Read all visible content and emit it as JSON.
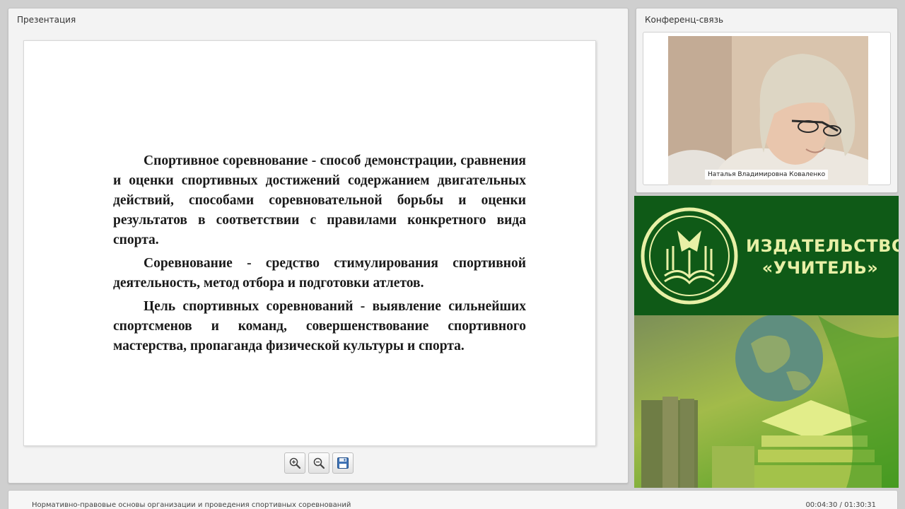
{
  "presentation": {
    "title": "Презентация",
    "paragraphs": [
      "Спортивное соревнование - способ демонстрации, сравнения и оценки спортивных достижений содержанием двигательных действий, способами соревновательной борьбы и оценки результатов в соответствии с правилами конкретного вида спорта.",
      "Соревнование - средство стимулирования спортивной деятельность, метод отбора и подготовки атлетов.",
      "Цель спортивных соревнований - выявление сильнейших спортсменов и команд, совершенствование спортивного мастерства, пропаганда физической культуры и спорта."
    ],
    "tools": [
      "zoom-in-icon",
      "zoom-out-icon",
      "save-icon"
    ]
  },
  "conference": {
    "title": "Конференц-связь",
    "participant_name": "Наталья Владимировна Коваленко"
  },
  "banner": {
    "line1": "ИЗДАТЕЛЬСТВО",
    "line2": "«УЧИТЕЛЬ»",
    "colors": {
      "green": "#0f5a17",
      "text": "#e8f0a6"
    }
  },
  "footer": {
    "course_title": "Нормативно-правовые основы организации и проведения спортивных соревнований",
    "time": "00:04:30 / 01:30:31"
  }
}
